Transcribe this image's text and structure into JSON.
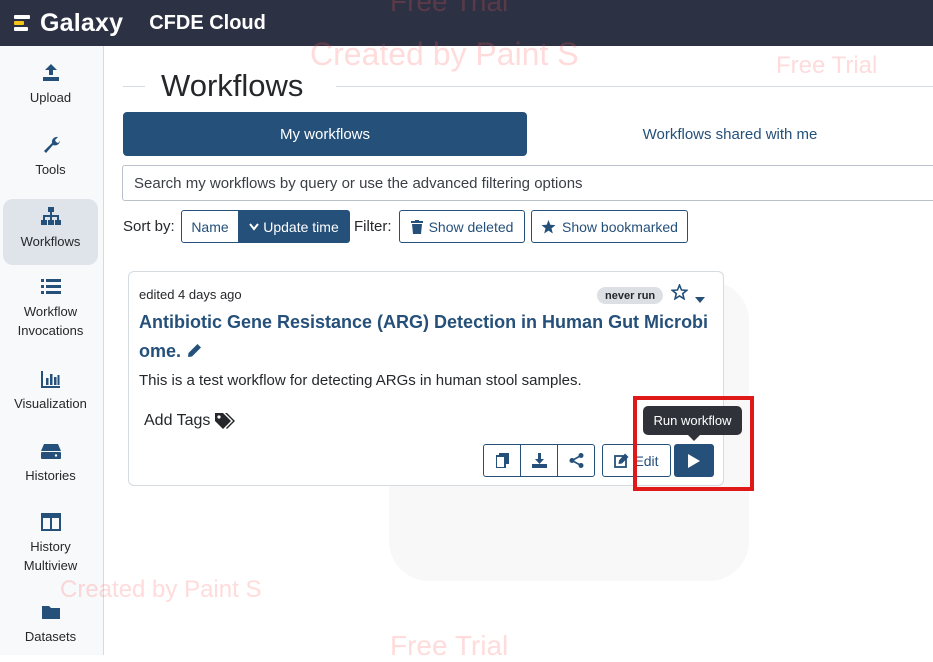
{
  "topbar": {
    "brand_name": "Galaxy",
    "brand_sub": "CFDE Cloud"
  },
  "sidebar": {
    "items": [
      {
        "label": "Upload",
        "icon": "upload-icon"
      },
      {
        "label": "Tools",
        "icon": "wrench-icon"
      },
      {
        "label": "Workflows",
        "icon": "sitemap-icon",
        "active": true
      },
      {
        "label": "Workflow Invocations",
        "line1": "Workflow",
        "line2": "Invocations",
        "icon": "list-icon"
      },
      {
        "label": "Visualization",
        "icon": "chart-icon"
      },
      {
        "label": "Histories",
        "icon": "hdd-icon"
      },
      {
        "label": "History Multiview",
        "line1": "History",
        "line2": "Multiview",
        "icon": "columns-icon"
      },
      {
        "label": "Datasets",
        "icon": "folder-icon"
      }
    ]
  },
  "main": {
    "title": "Workflows",
    "tabs": [
      {
        "label": "My workflows",
        "active": true
      },
      {
        "label": "Workflows shared with me",
        "active": false
      }
    ],
    "search": {
      "placeholder": "Search my workflows by query or use the advanced filtering options"
    },
    "sort": {
      "label": "Sort by:",
      "options": [
        "Name",
        "Update time"
      ],
      "selected": "Update time"
    },
    "filter": {
      "label": "Filter:",
      "show_deleted": "Show deleted",
      "show_bookmarked": "Show bookmarked"
    }
  },
  "workflow_card": {
    "edited": "edited 4 days ago",
    "badge": "never run",
    "title": "Antibiotic Gene Resistance (ARG) Detection in Human Gut Microbiome.",
    "description": "This is a test workflow for detecting ARGs in human stool samples.",
    "add_tags": "Add Tags",
    "edit_label": "Edit",
    "run_tooltip": "Run workflow"
  },
  "watermarks": [
    "Free Trial",
    "Created by Paint S",
    "Free Trial",
    "Created by Paint S",
    "Free Trial"
  ],
  "colors": {
    "topbar": "#2c3143",
    "primary": "#25507a",
    "highlight": "#e01818"
  }
}
